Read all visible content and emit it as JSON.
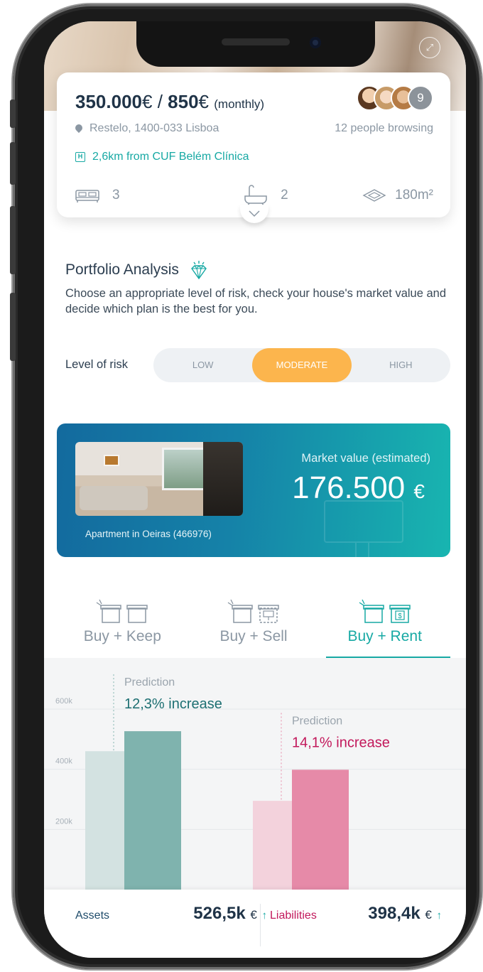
{
  "property": {
    "price": "350.000",
    "price_currency": "€",
    "separator": "/",
    "rent": "850",
    "rent_currency": "€",
    "rent_period": "(monthly)",
    "location": "Restelo, 1400-033 Lisboa",
    "browsing": "12 people browsing",
    "viewers_count": "9",
    "hospital": "2,6km from CUF Belém Clínica",
    "hospital_icon": "H",
    "bedrooms": "3",
    "bathrooms": "2",
    "area": "180m²"
  },
  "portfolio": {
    "title": "Portfolio Analysis",
    "description": "Choose an appropriate level of risk, check your house's market value and decide which plan is the best for you.",
    "risk_label": "Level of risk",
    "risk_options": [
      "LOW",
      "MODERATE",
      "HIGH"
    ],
    "risk_selected": "MODERATE"
  },
  "market": {
    "caption": "Apartment in Oeiras (466976)",
    "label": "Market value (estimated)",
    "value": "176.500",
    "currency": "€"
  },
  "plans": {
    "tabs": [
      "Buy + Keep",
      "Buy + Sell",
      "Buy + Rent"
    ],
    "selected": "Buy + Rent"
  },
  "colors": {
    "accent": "#17a9a4",
    "risk_active": "#fcb54d",
    "assets": "#7fb3ae",
    "assets_light": "#d3e2e1",
    "liabilities": "#e68aa8",
    "liabilities_light": "#f3d2dc"
  },
  "chart_data": {
    "type": "bar",
    "ytick_labels": [
      "200k",
      "400k",
      "600k"
    ],
    "yticks": [
      200,
      400,
      600
    ],
    "ylim": [
      0,
      770
    ],
    "groups": [
      {
        "name": "Assets",
        "current": 460,
        "predicted": 526.5,
        "prediction_label": "Prediction",
        "prediction_text": "12,3% increase"
      },
      {
        "name": "Liabilities",
        "current": 295,
        "predicted": 398.4,
        "prediction_label": "Prediction",
        "prediction_text": "14,1% increase"
      }
    ]
  },
  "summary": {
    "assets_label": "Assets",
    "assets_value": "526,5k",
    "assets_unit": "€",
    "liabilities_label": "Liabilities",
    "liabilities_value": "398,4k",
    "liabilities_unit": "€",
    "arrow": "↑"
  }
}
